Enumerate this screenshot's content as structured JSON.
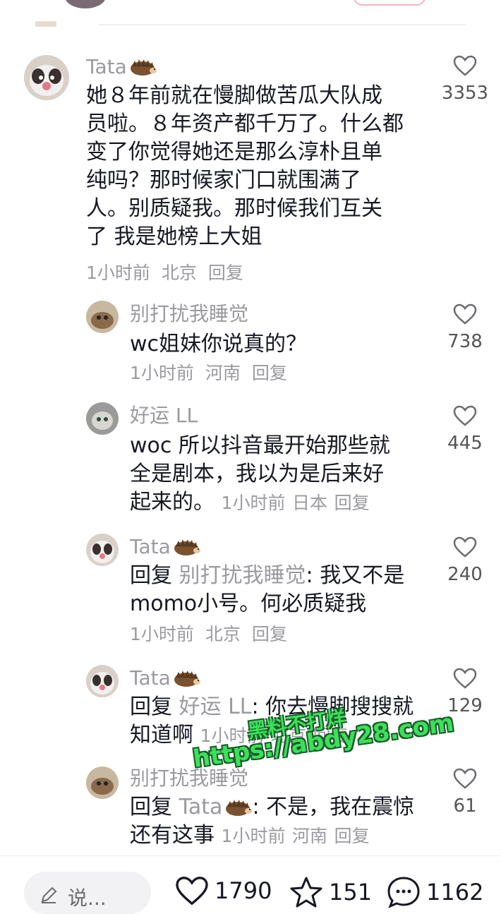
{
  "comments": [
    {
      "user": "Tata",
      "lines": [
        "她８年前就在慢脚做苦瓜大队成",
        "员啦。８年资产都千万了。什么都",
        "变了你觉得她还是那么淳朴且单",
        "纯吗？那时候家门口就围满了",
        "人。别质疑我。那时候我们互关",
        "了 我是她榜上大姐"
      ],
      "time": "1小时前",
      "location": "北京",
      "reply_label": "回复",
      "likes": "3353"
    },
    {
      "user": "别打扰我睡觉",
      "lines": [
        "wc姐妹你说真的？"
      ],
      "time": "1小时前",
      "location": "河南",
      "reply_label": "回复",
      "likes": "738"
    },
    {
      "user": "好运 LL",
      "lines": [
        "woc 所以抖音最开始那些就",
        "全是剧本，我以为是后来好",
        "起来的。"
      ],
      "time": "1小时前",
      "location": "日本",
      "reply_label": "回复",
      "likes": "445"
    },
    {
      "user": "Tata",
      "reply_prefix": "回复",
      "reply_to": "别打扰我睡觉",
      "lines": [
        ": 我又不是",
        "momo小号。何必质疑我"
      ],
      "time": "1小时前",
      "location": "北京",
      "reply_label": "回复",
      "likes": "240"
    },
    {
      "user": "Tata",
      "reply_prefix": "回复",
      "reply_to": "好运 LL",
      "lines": [
        ": 你去慢脚搜搜就",
        "知道啊"
      ],
      "time": "1小时前",
      "location": "北京",
      "reply_label": "回复",
      "likes": "129"
    },
    {
      "user": "别打扰我睡觉",
      "reply_prefix": "回复",
      "reply_to": "Tata",
      "lines": [
        ": 不是，我在震惊",
        "还有这事"
      ],
      "time": "1小时前",
      "location": "河南",
      "reply_label": "回复",
      "likes": "61"
    }
  ],
  "bottom_bar": {
    "input_placeholder": "说...",
    "likes": "1790",
    "favorites": "151",
    "comments": "1162"
  },
  "watermark": {
    "line1": "黑料不打烊",
    "line2": "https://abdy28.com"
  },
  "colors": {
    "text": "#161823",
    "muted": "#9a9aa0",
    "watermark": "#3ce05a"
  }
}
